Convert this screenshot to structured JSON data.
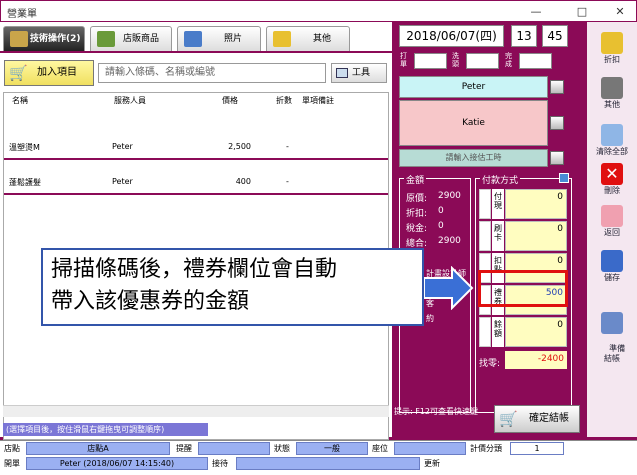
{
  "window": {
    "title": "營業單",
    "min": "—",
    "max": "□",
    "close": "✕"
  },
  "tabs": [
    {
      "label": "技術操作(2)"
    },
    {
      "label": "店販商品"
    },
    {
      "label": "照片"
    },
    {
      "label": "其他"
    }
  ],
  "toolbar": {
    "add_label": "加入項目",
    "search_placeholder": "請輸入條碼、名稱或編號",
    "tool_label": "工具"
  },
  "table": {
    "headers": [
      "名稱",
      "服務人員",
      "價格",
      "折數",
      "單項備註"
    ],
    "rows": [
      {
        "name": "溫塑燙M",
        "staff": "Peter",
        "price": "2,500",
        "discount": "-"
      },
      {
        "name": "蓬鬆護髮",
        "staff": "Peter",
        "price": "400",
        "discount": "-"
      }
    ]
  },
  "hint": "(選擇項目後，按住滑鼠右鍵拖曳可調整順序)",
  "datetime": {
    "date": "2018/06/07(四)",
    "hour": "13",
    "minute": "45"
  },
  "checkin": {
    "in": "打\n單",
    "wash": "洗\n頭",
    "done": "完\n成"
  },
  "staff": {
    "designer": "Peter",
    "assistant": "Katie",
    "input_hint": "請輸入接估工時"
  },
  "amount": {
    "title": "金額",
    "lines": [
      {
        "label": "原價:",
        "value": "2900"
      },
      {
        "label": "折扣:",
        "value": "0"
      },
      {
        "label": "稅金:",
        "value": "0"
      },
      {
        "label": "總合:",
        "value": "2900"
      }
    ],
    "extra": [
      "計畫設計師",
      "回",
      "客",
      "約"
    ]
  },
  "payment": {
    "title": "付款方式",
    "items": [
      {
        "name": "付現",
        "value": "0"
      },
      {
        "name": "刷卡",
        "value": "0"
      },
      {
        "name": "扣點",
        "value": "0"
      },
      {
        "name": "禮券",
        "value": "500"
      },
      {
        "name": "餘額",
        "value": "0"
      }
    ],
    "change_label": "找零:",
    "change_value": "-2400"
  },
  "tip": "提示: F12可查看快速鍵",
  "checkout_label": "確定結帳",
  "sidebar": [
    {
      "label": "折扣"
    },
    {
      "label": "其他"
    },
    {
      "label": "清除全部"
    },
    {
      "label": "刪除"
    },
    {
      "label": "返回"
    },
    {
      "label": "儲存"
    },
    {
      "label": "準備\n結帳"
    }
  ],
  "status": {
    "store_label": "店點",
    "store": "店點A",
    "reminder_label": "提醒",
    "state_label": "狀態",
    "state": "一般",
    "seat_label": "座位",
    "timer_label": "計價分頭",
    "timer": "1",
    "opener_label": "開單",
    "opener": "Peter (2018/06/07 14:15:40)",
    "reception_label": "接待",
    "update_label": "更新"
  },
  "callout": {
    "line1": "掃描條碼後，禮券欄位會自動",
    "line2": "帶入該優惠券的金額"
  },
  "colors": {
    "frame": "#8b0a57",
    "accent": "#e01010",
    "status_field": "#9bb0f2"
  }
}
